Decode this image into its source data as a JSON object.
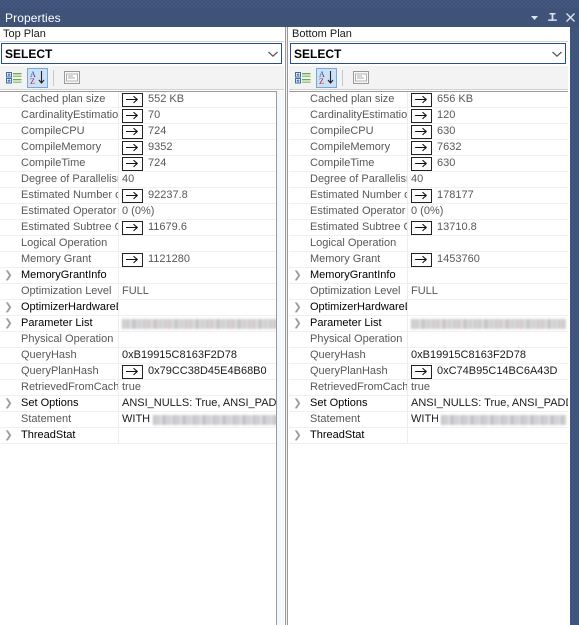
{
  "window": {
    "title": "Properties",
    "controls": [
      {
        "name": "dropdown-menu-icon",
        "glyph": "▾",
        "label": "Window Position Menu"
      },
      {
        "name": "pin-icon",
        "glyph": "⊥",
        "label": "Auto Hide"
      },
      {
        "name": "close-icon",
        "glyph": "✕",
        "label": "Close"
      }
    ]
  },
  "toolbar": {
    "categorized_label": "Categorized",
    "alphabetic_label": "Alphabetical",
    "property_pages_label": "Property Pages"
  },
  "panes": [
    {
      "header": "Top Plan",
      "combo_value": "SELECT",
      "rows": [
        {
          "expandable": false,
          "name": "Cached plan size",
          "arrow": true,
          "value": "552 KB"
        },
        {
          "expandable": false,
          "name": "CardinalityEstimation",
          "arrow": true,
          "value": "70"
        },
        {
          "expandable": false,
          "name": "CompileCPU",
          "arrow": true,
          "value": "724"
        },
        {
          "expandable": false,
          "name": "CompileMemory",
          "arrow": true,
          "value": "9352"
        },
        {
          "expandable": false,
          "name": "CompileTime",
          "arrow": true,
          "value": "724"
        },
        {
          "expandable": false,
          "name": "Degree of Parallelism",
          "arrow": false,
          "value": "40"
        },
        {
          "expandable": false,
          "name": "Estimated Number of",
          "arrow": true,
          "value": "92237.8"
        },
        {
          "expandable": false,
          "name": "Estimated Operator C",
          "arrow": false,
          "value": "0 (0%)"
        },
        {
          "expandable": false,
          "name": "Estimated Subtree C",
          "arrow": true,
          "value": "11679.6"
        },
        {
          "expandable": false,
          "name": "Logical Operation",
          "arrow": false,
          "value": ""
        },
        {
          "expandable": false,
          "name": "Memory Grant",
          "arrow": true,
          "value": "1121280"
        },
        {
          "expandable": true,
          "name": "MemoryGrantInfo",
          "arrow": false,
          "value": ""
        },
        {
          "expandable": false,
          "name": "Optimization Level",
          "arrow": false,
          "value": "FULL"
        },
        {
          "expandable": true,
          "name": "OptimizerHardwareD",
          "arrow": false,
          "value": ""
        },
        {
          "expandable": true,
          "name": "Parameter List",
          "arrow": false,
          "value": "",
          "redacted": "full"
        },
        {
          "expandable": false,
          "name": "Physical Operation",
          "arrow": false,
          "value": ""
        },
        {
          "expandable": false,
          "name": "QueryHash",
          "arrow": false,
          "value": "0xB19915C8163F2D78",
          "dark": true
        },
        {
          "expandable": false,
          "name": "QueryPlanHash",
          "arrow": true,
          "value": "0x79CC38D45E4B68B0",
          "dark": true
        },
        {
          "expandable": false,
          "name": "RetrievedFromCache",
          "arrow": false,
          "value": "true"
        },
        {
          "expandable": true,
          "name": "Set Options",
          "arrow": false,
          "value": "ANSI_NULLS: True, ANSI_PADD",
          "dark": true
        },
        {
          "expandable": false,
          "name": "Statement",
          "arrow": false,
          "value": "WITH",
          "dark": true,
          "redacted": "partial"
        },
        {
          "expandable": true,
          "name": "ThreadStat",
          "arrow": false,
          "value": ""
        }
      ]
    },
    {
      "header": "Bottom Plan",
      "combo_value": "SELECT",
      "rows": [
        {
          "expandable": false,
          "name": "Cached plan size",
          "arrow": true,
          "value": "656 KB"
        },
        {
          "expandable": false,
          "name": "CardinalityEstimation",
          "arrow": true,
          "value": "120"
        },
        {
          "expandable": false,
          "name": "CompileCPU",
          "arrow": true,
          "value": "630"
        },
        {
          "expandable": false,
          "name": "CompileMemory",
          "arrow": true,
          "value": "7632"
        },
        {
          "expandable": false,
          "name": "CompileTime",
          "arrow": true,
          "value": "630"
        },
        {
          "expandable": false,
          "name": "Degree of Parallelism",
          "arrow": false,
          "value": "40"
        },
        {
          "expandable": false,
          "name": "Estimated Number o",
          "arrow": true,
          "value": "178177"
        },
        {
          "expandable": false,
          "name": "Estimated Operator (",
          "arrow": false,
          "value": "0 (0%)"
        },
        {
          "expandable": false,
          "name": "Estimated Subtree C",
          "arrow": true,
          "value": "13710.8"
        },
        {
          "expandable": false,
          "name": "Logical Operation",
          "arrow": false,
          "value": ""
        },
        {
          "expandable": false,
          "name": "Memory Grant",
          "arrow": true,
          "value": "1453760"
        },
        {
          "expandable": true,
          "name": "MemoryGrantInfo",
          "arrow": false,
          "value": ""
        },
        {
          "expandable": false,
          "name": "Optimization Level",
          "arrow": false,
          "value": "FULL"
        },
        {
          "expandable": true,
          "name": "OptimizerHardwareD",
          "arrow": false,
          "value": ""
        },
        {
          "expandable": true,
          "name": "Parameter List",
          "arrow": false,
          "value": "",
          "redacted": "full"
        },
        {
          "expandable": false,
          "name": "Physical Operation",
          "arrow": false,
          "value": ""
        },
        {
          "expandable": false,
          "name": "QueryHash",
          "arrow": false,
          "value": "0xB19915C8163F2D78",
          "dark": true
        },
        {
          "expandable": false,
          "name": "QueryPlanHash",
          "arrow": true,
          "value": "0xC74B95C14BC6A43D",
          "dark": true
        },
        {
          "expandable": false,
          "name": "RetrievedFromCach",
          "arrow": false,
          "value": "true"
        },
        {
          "expandable": true,
          "name": "Set Options",
          "arrow": false,
          "value": "ANSI_NULLS: True, ANSI_PADD",
          "dark": true
        },
        {
          "expandable": false,
          "name": "Statement",
          "arrow": false,
          "value": "WITH",
          "dark": true,
          "redacted": "partial"
        },
        {
          "expandable": true,
          "name": "ThreadStat",
          "arrow": false,
          "value": ""
        }
      ]
    }
  ],
  "colors": {
    "titlebar": "#3f5277",
    "grip": "#3d5179",
    "combo_border": "#2a4d8f",
    "toolbar_bg": "#f3f3f3",
    "selected_tool": "#cce1f5",
    "row_text": "#585858",
    "row_text_dark": "#1a1a1a"
  }
}
